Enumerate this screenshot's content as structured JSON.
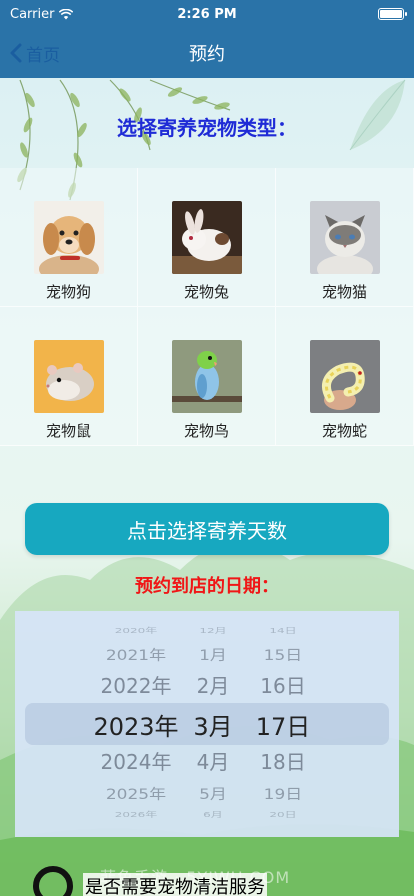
{
  "status_bar": {
    "carrier": "Carrier",
    "time": "2:26 PM"
  },
  "nav": {
    "back_label": "首页",
    "title": "预约"
  },
  "section_title": "选择寄养宠物类型：",
  "pets": [
    {
      "label": "宠物狗",
      "icon": "dog-photo"
    },
    {
      "label": "宠物兔",
      "icon": "rabbit-photo"
    },
    {
      "label": "宠物猫",
      "icon": "cat-photo"
    },
    {
      "label": "宠物鼠",
      "icon": "hamster-photo"
    },
    {
      "label": "宠物鸟",
      "icon": "bird-photo"
    },
    {
      "label": "宠物蛇",
      "icon": "snake-photo"
    }
  ],
  "days_button_label": "点击选择寄养天数",
  "date_title": "预约到店的日期：",
  "date_picker": {
    "rows": [
      {
        "year": "2020年",
        "month": "12月",
        "day": "14日"
      },
      {
        "year": "2021年",
        "month": "1月",
        "day": "15日"
      },
      {
        "year": "2022年",
        "month": "2月",
        "day": "16日"
      },
      {
        "year": "2023年",
        "month": "3月",
        "day": "17日"
      },
      {
        "year": "2024年",
        "month": "4月",
        "day": "18日"
      },
      {
        "year": "2025年",
        "month": "5月",
        "day": "19日"
      },
      {
        "year": "2026年",
        "month": "6月",
        "day": "20日"
      }
    ],
    "selected": {
      "year": "2023年",
      "month": "3月",
      "day": "17日"
    }
  },
  "clean_service_label": "是否需要宠物清洁服务",
  "watermark": "菲鱼手游 · 5YIWU.COM",
  "colors": {
    "nav_bar": "#2a73a8",
    "section_title": "#1f2bd6",
    "days_button": "#17a8c0",
    "date_title": "#f01616"
  }
}
